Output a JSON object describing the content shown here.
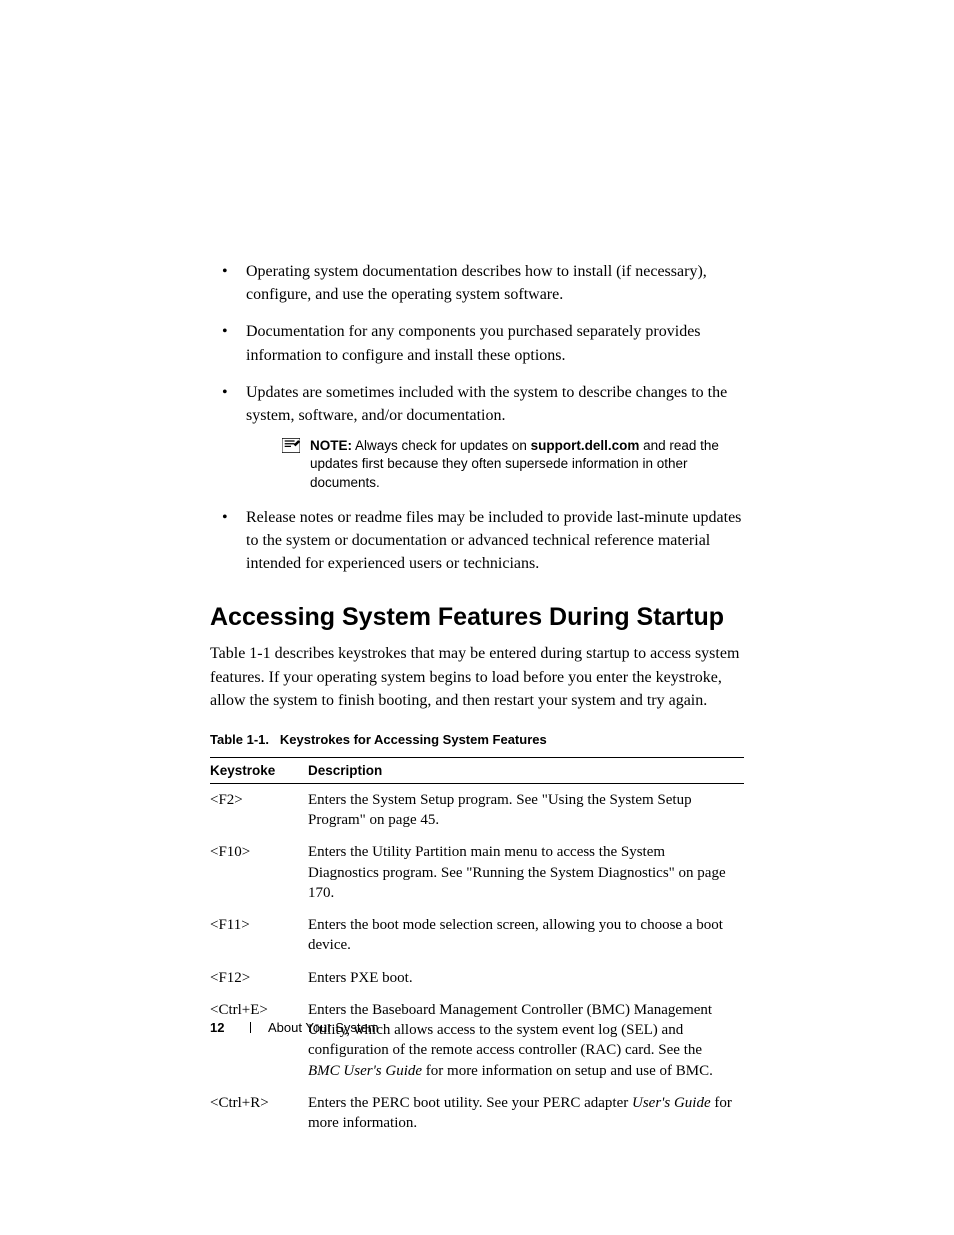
{
  "bullets": [
    "Operating system documentation describes how to install (if necessary), configure, and use the operating system software.",
    "Documentation for any components you purchased separately provides information to configure and install these options.",
    "Updates are sometimes included with the system to describe changes to the system, software, and/or documentation.",
    "Release notes or readme files may be included to provide last-minute updates to the system or documentation or advanced technical reference material intended for experienced users or technicians."
  ],
  "note": {
    "label": "NOTE:",
    "pre": " Always check for updates on ",
    "site": "support.dell.com",
    "post": " and read the updates first because they often supersede information in other documents."
  },
  "section_heading": "Accessing System Features During Startup",
  "section_body": "Table 1-1 describes keystrokes that may be entered during startup to access system features. If your operating system begins to load before you enter the keystroke, allow the system to finish booting, and then restart your system and try again.",
  "table": {
    "caption_ref": "Table 1-1.",
    "caption_title": "Keystrokes for Accessing System Features",
    "headers": {
      "col1": "Keystroke",
      "col2": "Description"
    },
    "rows": [
      {
        "key": "<F2>",
        "desc": "Enters the System Setup program. See \"Using the System Setup Program\" on page 45."
      },
      {
        "key": "<F10>",
        "desc": "Enters the Utility Partition main menu to access the System Diagnostics program. See \"Running the System Diagnostics\" on page 170."
      },
      {
        "key": "<F11>",
        "desc": "Enters the boot mode selection screen, allowing you to choose a boot device."
      },
      {
        "key": "<F12>",
        "desc": "Enters PXE boot."
      },
      {
        "key": "<Ctrl+E>",
        "desc_pre": "Enters the Baseboard Management Controller (BMC) Management Utility, which allows access to the system event log (SEL) and configuration of the remote access controller (RAC) card. See the ",
        "desc_italic": "BMC User's Guide",
        "desc_post": " for more information on setup and use of BMC."
      },
      {
        "key": "<Ctrl+R>",
        "desc_pre": "Enters the PERC boot utility. See your PERC adapter ",
        "desc_italic": "User's Guide",
        "desc_post": " for more information."
      }
    ]
  },
  "footer": {
    "page": "12",
    "section": "About Your System"
  }
}
